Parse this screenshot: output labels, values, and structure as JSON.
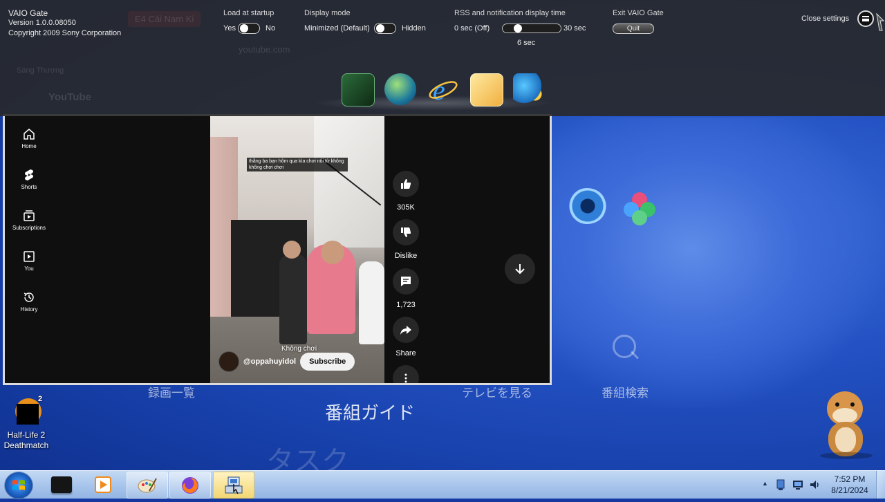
{
  "wallpaper": {
    "labels": {
      "recordings": "録画一覧",
      "tv": "テレビを見る",
      "search": "番組検索",
      "guide": "番組ガイド",
      "task": "タスク"
    }
  },
  "youtube": {
    "sidebar": [
      {
        "label": "Home",
        "icon": "home-icon"
      },
      {
        "label": "Shorts",
        "icon": "shorts-icon"
      },
      {
        "label": "Subscriptions",
        "icon": "subscriptions-icon"
      },
      {
        "label": "You",
        "icon": "you-icon"
      },
      {
        "label": "History",
        "icon": "history-icon"
      }
    ],
    "short": {
      "caption_top": "thằng ba bạn hôm qua kìa chơi nổi từ không không chơi chơi",
      "caption_bottom": "Không chơi",
      "channel": "@oppahuyidol",
      "subscribe_label": "Subscribe"
    },
    "actions": {
      "likes": "305K",
      "dislike_label": "Dislike",
      "comments": "1,723",
      "share_label": "Share"
    }
  },
  "vaio_gate": {
    "title": "VAIO Gate",
    "version": "Version 1.0.0.08050",
    "copyright": "Copyright 2009 Sony Corporation",
    "load_at_startup": {
      "header": "Load at startup",
      "yes": "Yes",
      "no": "No",
      "value": "Yes"
    },
    "display_mode": {
      "header": "Display mode",
      "option_a": "Minimized (Default)",
      "option_b": "Hidden",
      "value": "Minimized (Default)"
    },
    "rss": {
      "header": "RSS and notification display time",
      "min": "0 sec (Off)",
      "max": "30 sec",
      "current": "6 sec",
      "value_sec": 6
    },
    "exit": {
      "header": "Exit VAIO Gate",
      "quit_label": "Quit"
    },
    "close_settings": "Close settings",
    "ghost_tab": "E4 Cái Nam Ki",
    "ghost_url": "youtube.com",
    "ghost_bookmark": "Sáng Thương",
    "ghost_logo": "YouTube",
    "dock": [
      "dock-app-icon",
      "dock-globe-icon",
      "dock-ie-icon",
      "dock-mail-icon",
      "dock-windows-live-icon"
    ]
  },
  "desktop": {
    "icons": [
      {
        "label": "Half-Life 2 Deathmatch",
        "badge": "2"
      }
    ]
  },
  "taskbar": {
    "buttons": [
      "start-button",
      "app-black-box",
      "media-player",
      "paint",
      "firefox",
      "vaio-gate-app"
    ],
    "time": "7:52 PM",
    "date": "8/21/2024",
    "tray_arrow": "▲"
  },
  "colors": {
    "youtube_bg": "#0f0f0f",
    "vaio_panel": "#282828",
    "desktop": "#1f49b8",
    "taskbar": "#a9c6ec"
  }
}
